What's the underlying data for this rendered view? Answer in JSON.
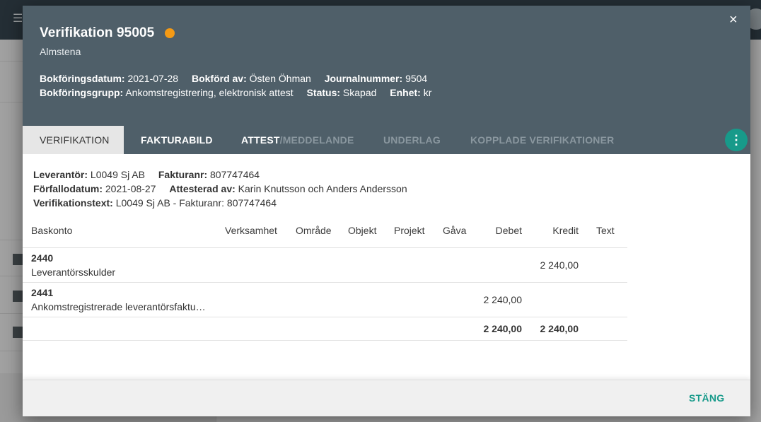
{
  "dialog": {
    "title": "Verifikation 95005",
    "subtitle": "Almstena",
    "status_color": "#f59a14",
    "close_icon": "×",
    "meta_row1": [
      {
        "label": "Bokföringsdatum:",
        "value": "2021-07-28"
      },
      {
        "label": "Bokförd av:",
        "value": "Östen Öhman"
      },
      {
        "label": "Journalnummer:",
        "value": "9504"
      }
    ],
    "meta_row2": [
      {
        "label": "Bokföringsgrupp:",
        "value": "Ankomstregistrering, elektronisk attest"
      },
      {
        "label": "Status:",
        "value": "Skapad"
      },
      {
        "label": "Enhet:",
        "value": "kr"
      }
    ]
  },
  "tabs": {
    "verifikation": "Verifikation",
    "fakturabild": "Fakturabild",
    "attest_a": "Attest",
    "attest_b": "/Meddelande",
    "underlag": "Underlag",
    "kopplade": "Kopplade verifikationer",
    "more_icon": "⋮"
  },
  "info": {
    "row1": [
      {
        "label": "Leverantör:",
        "value": "L0049 Sj AB"
      },
      {
        "label": "Fakturanr:",
        "value": "807747464"
      }
    ],
    "row2": [
      {
        "label": "Förfallodatum:",
        "value": "2021-08-27"
      },
      {
        "label": "Attesterad av:",
        "value": "Karin Knutsson och Anders Andersson"
      }
    ],
    "row3": [
      {
        "label": "Verifikationstext:",
        "value": "L0049 Sj AB - Fakturanr: 807747464"
      }
    ]
  },
  "table": {
    "headers": {
      "baskonto": "Baskonto",
      "verksamhet": "Verksamhet",
      "omrade": "Område",
      "objekt": "Objekt",
      "projekt": "Projekt",
      "gava": "Gåva",
      "debet": "Debet",
      "kredit": "Kredit",
      "text": "Text"
    },
    "rows": [
      {
        "account": "2440",
        "name": "Leverantörsskulder",
        "debet": "",
        "kredit": "2 240,00"
      },
      {
        "account": "2441",
        "name": "Ankomstregistrerade leverantörsfaktu…",
        "debet": "2 240,00",
        "kredit": ""
      }
    ],
    "totals": {
      "debet": "2 240,00",
      "kredit": "2 240,00"
    }
  },
  "footer": {
    "close_label": "STÄNG"
  }
}
